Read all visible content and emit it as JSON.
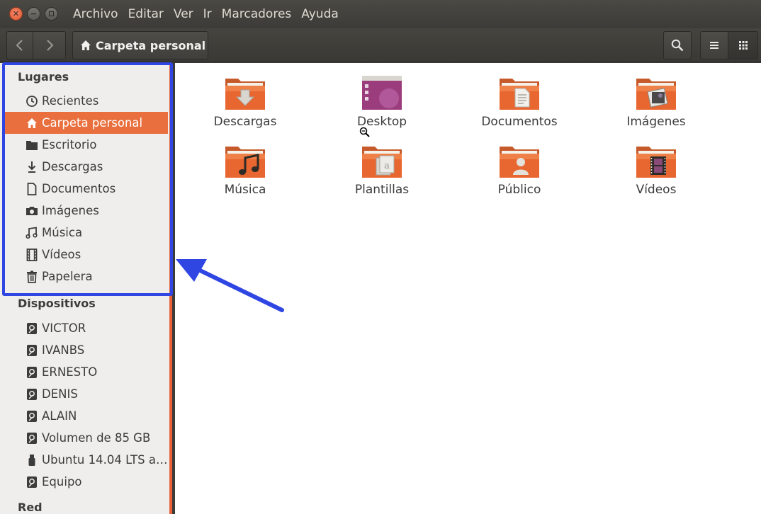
{
  "menubar": {
    "items": [
      "Archivo",
      "Editar",
      "Ver",
      "Ir",
      "Marcadores",
      "Ayuda"
    ]
  },
  "toolbar": {
    "path_label": "Carpeta personal"
  },
  "sidebar": {
    "places_title": "Lugares",
    "places": [
      {
        "label": "Recientes",
        "icon": "clock-icon"
      },
      {
        "label": "Carpeta personal",
        "icon": "home-icon",
        "active": true
      },
      {
        "label": "Escritorio",
        "icon": "folder-icon"
      },
      {
        "label": "Descargas",
        "icon": "download-icon"
      },
      {
        "label": "Documentos",
        "icon": "document-icon"
      },
      {
        "label": "Imágenes",
        "icon": "camera-icon"
      },
      {
        "label": "Música",
        "icon": "music-icon"
      },
      {
        "label": "Vídeos",
        "icon": "film-icon"
      },
      {
        "label": "Papelera",
        "icon": "trash-icon"
      }
    ],
    "devices_title": "Dispositivos",
    "devices": [
      {
        "label": "VICTOR",
        "icon": "drive-icon"
      },
      {
        "label": "IVANBS",
        "icon": "drive-icon"
      },
      {
        "label": "ERNESTO",
        "icon": "drive-icon"
      },
      {
        "label": "DENIS",
        "icon": "drive-icon"
      },
      {
        "label": "ALAIN",
        "icon": "drive-icon"
      },
      {
        "label": "Volumen de 85 GB",
        "icon": "drive-icon"
      },
      {
        "label": "Ubuntu 14.04 LTS a…",
        "icon": "usb-icon"
      },
      {
        "label": "Equipo",
        "icon": "drive-icon"
      }
    ],
    "network_title": "Red"
  },
  "files": [
    {
      "name": "Descargas",
      "emblem": "download"
    },
    {
      "name": "Desktop",
      "emblem": "desktop"
    },
    {
      "name": "Documentos",
      "emblem": "document"
    },
    {
      "name": "Imágenes",
      "emblem": "picture"
    },
    {
      "name": "Música",
      "emblem": "music"
    },
    {
      "name": "Plantillas",
      "emblem": "template"
    },
    {
      "name": "Público",
      "emblem": "person"
    },
    {
      "name": "Vídeos",
      "emblem": "film"
    }
  ],
  "colors": {
    "accent": "#e9703e",
    "annotation": "#2f46e3",
    "folder": "#e8662f"
  }
}
